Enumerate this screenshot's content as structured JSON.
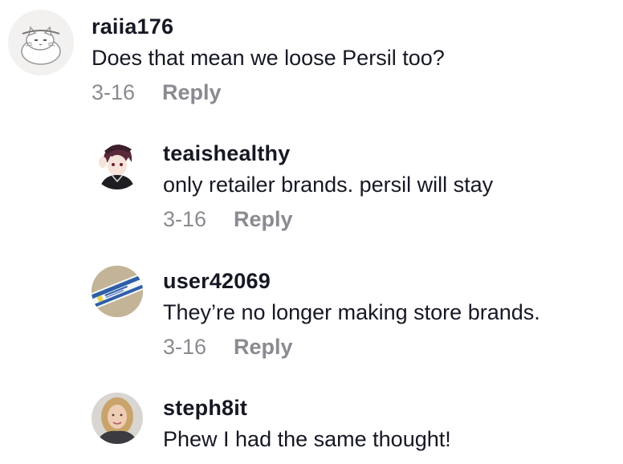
{
  "comments": [
    {
      "username": "raiia176",
      "text": "Does that mean we loose Persil too?",
      "date": "3-16",
      "reply_label": "Reply",
      "avatar_icon": "cat-avatar"
    },
    {
      "username": "teaishealthy",
      "text": "only retailer brands. persil will stay",
      "date": "3-16",
      "reply_label": "Reply",
      "avatar_icon": "anime-character-avatar"
    },
    {
      "username": "user42069",
      "text": "They’re no longer making store brands.",
      "date": "3-16",
      "reply_label": "Reply",
      "avatar_icon": "product-package-avatar"
    },
    {
      "username": "steph8it",
      "text": "Phew I had the same thought!",
      "avatar_icon": "woman-photo-avatar"
    }
  ],
  "colors": {
    "username": "#161823",
    "text": "#161823",
    "meta": "#8a8b91"
  }
}
